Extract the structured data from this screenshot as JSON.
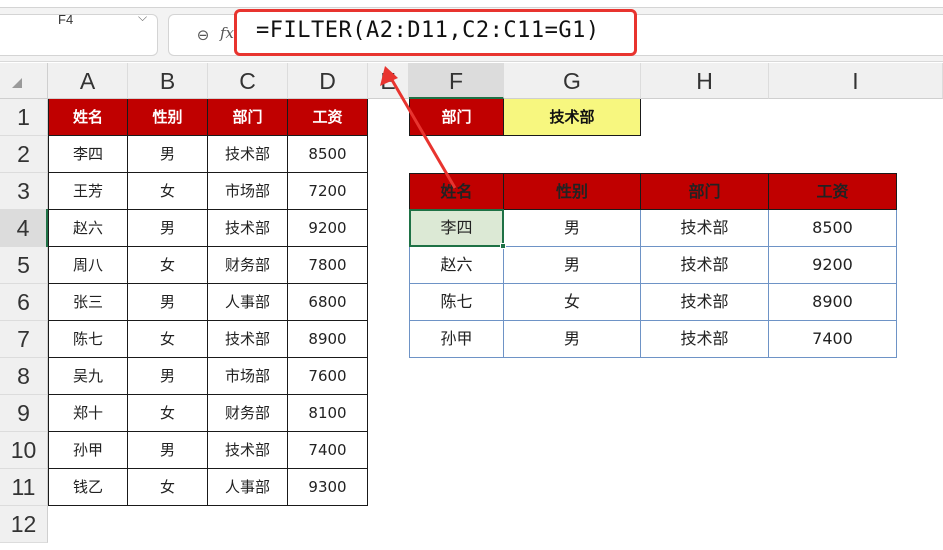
{
  "toolbar": {
    "name_box": "F4",
    "name_box_caret": "⌵",
    "zoom_icon": "⊖",
    "fx_label": "fx",
    "formula": "=FILTER(A2:D11,C2:C11=G1)"
  },
  "columns": [
    "A",
    "B",
    "C",
    "D",
    "E",
    "F",
    "G",
    "H",
    "I"
  ],
  "rows": [
    "1",
    "2",
    "3",
    "4",
    "5",
    "6",
    "7",
    "8",
    "9",
    "10",
    "11",
    "12"
  ],
  "selected_cell": "F4",
  "source_table": {
    "headers": [
      "姓名",
      "性别",
      "部门",
      "工资"
    ],
    "rows": [
      [
        "李四",
        "男",
        "技术部",
        "8500"
      ],
      [
        "王芳",
        "女",
        "市场部",
        "7200"
      ],
      [
        "赵六",
        "男",
        "技术部",
        "9200"
      ],
      [
        "周八",
        "女",
        "财务部",
        "7800"
      ],
      [
        "张三",
        "男",
        "人事部",
        "6800"
      ],
      [
        "陈七",
        "女",
        "技术部",
        "8900"
      ],
      [
        "吴九",
        "男",
        "市场部",
        "7600"
      ],
      [
        "郑十",
        "女",
        "财务部",
        "8100"
      ],
      [
        "孙甲",
        "男",
        "技术部",
        "7400"
      ],
      [
        "钱乙",
        "女",
        "人事部",
        "9300"
      ]
    ]
  },
  "criteria": {
    "label": "部门",
    "value": "技术部"
  },
  "result_table": {
    "headers": [
      "姓名",
      "性别",
      "部门",
      "工资"
    ],
    "rows": [
      [
        "李四",
        "男",
        "技术部",
        "8500"
      ],
      [
        "赵六",
        "男",
        "技术部",
        "9200"
      ],
      [
        "陈七",
        "女",
        "技术部",
        "8900"
      ],
      [
        "孙甲",
        "男",
        "技术部",
        "7400"
      ]
    ]
  },
  "colors": {
    "header_red": "#c00000",
    "criteria_yellow": "#f7f77f",
    "annotation_red": "#e8342f",
    "selection_green": "#1e7145"
  }
}
